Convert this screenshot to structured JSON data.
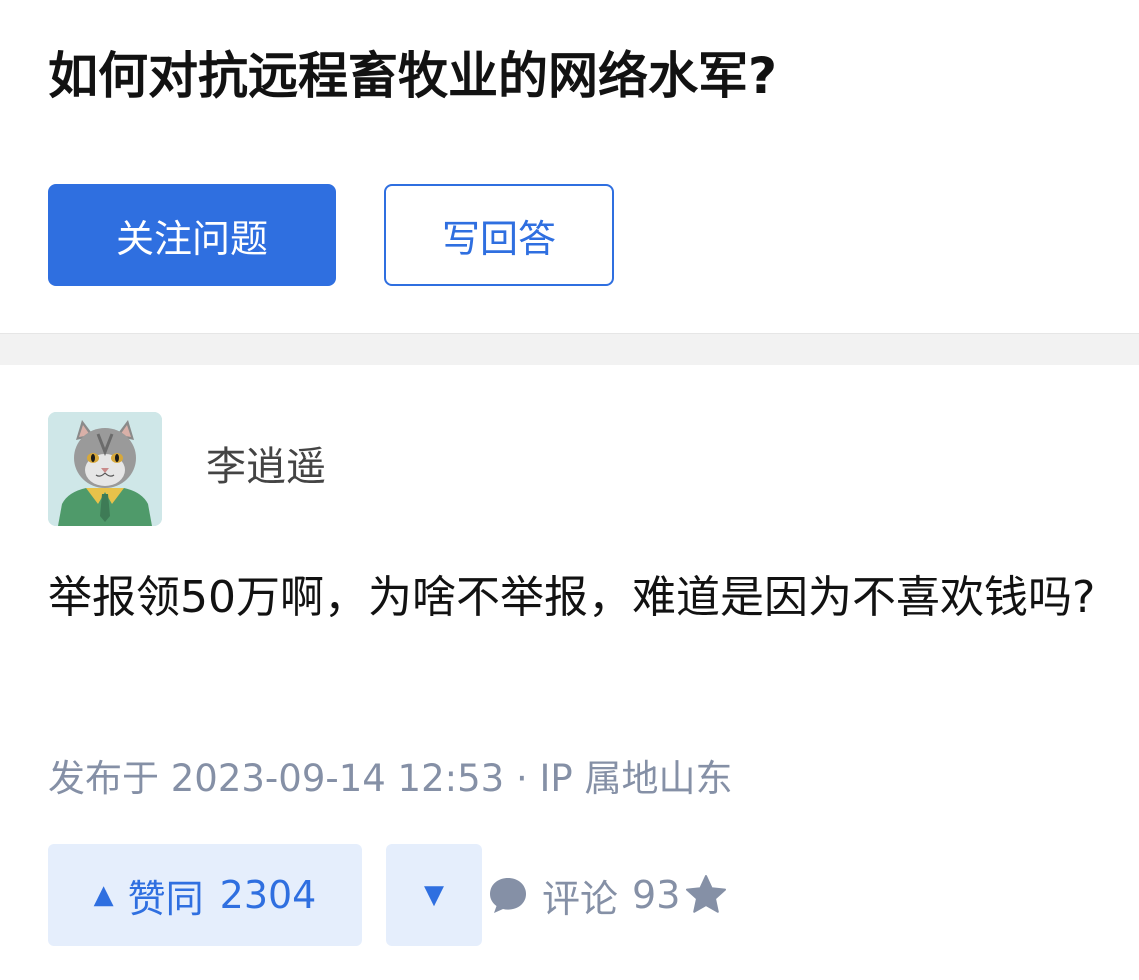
{
  "question": {
    "title": "如何对抗远程畜牧业的网络水军?",
    "follow_label": "关注问题",
    "answer_label": "写回答"
  },
  "answer": {
    "author": "李逍遥",
    "text": "举报领50万啊，为啥不举报，难道是因为不喜欢钱吗?",
    "meta": "发布于 2023-09-14 12:53 · IP 属地山东",
    "vote_up_label": "赞同",
    "vote_up_count": "2304",
    "comment_label": "评论",
    "comment_count": "93"
  },
  "icons": {
    "vote_up": "triangle-up-icon",
    "vote_down": "triangle-down-icon",
    "comment": "comment-bubble-icon",
    "favorite": "star-icon",
    "avatar": "cat-in-sweater-avatar"
  },
  "colors": {
    "accent": "#2f6fe0",
    "vote_bg": "#e5eefc",
    "meta_text": "#8590a6",
    "title_text": "#121212"
  }
}
